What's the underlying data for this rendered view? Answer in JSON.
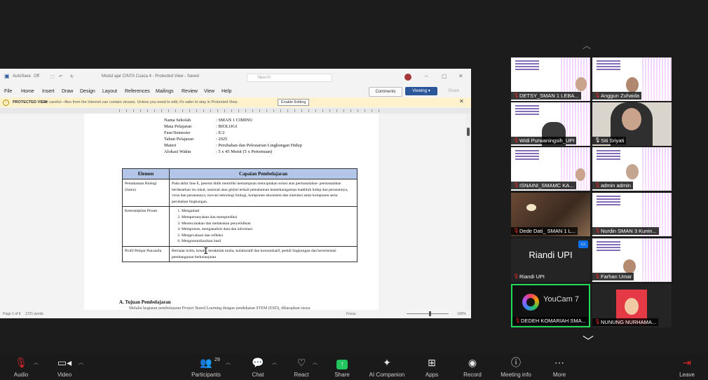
{
  "document": {
    "titlebar": {
      "autosave": "AutoSave",
      "autosave_state": "Off",
      "filename": "Modul ajar CINTA Cuaca 4  -  Protected View  -  Saved",
      "search_placeholder": "Search"
    },
    "menu": [
      "File",
      "Home",
      "Insert",
      "Draw",
      "Design",
      "Layout",
      "References",
      "Mailings",
      "Review",
      "View",
      "Help"
    ],
    "comments_label": "Comments",
    "viewing_label": "Viewing",
    "share_label": "Share",
    "protected_view": {
      "label": "PROTECTED VIEW",
      "message": "Be careful—files from the Internet can contain viruses. Unless you need to edit, it's safer to stay in Protected View.",
      "enable_button": "Enable Editing"
    },
    "status": {
      "page": "Page 1 of 6",
      "words": "1721 words",
      "focus": "Focus",
      "zoom": "100%"
    },
    "identity": [
      {
        "key": "Nama Sekolah",
        "value": ": SMAN 1 CIMINU"
      },
      {
        "key": "Mata Pelajaran",
        "value": ": BIOLOGI"
      },
      {
        "key": "Fase/Semester",
        "value": ": E/2"
      },
      {
        "key": "Tahun Pelajaran",
        "value": ": 2025"
      },
      {
        "key": "Materi",
        "value": ": Perubahan dan Pelestarian Lingkungan Hidup"
      },
      {
        "key": "Alokasi Waktu",
        "value": ": 5 x 45 Menit (5 x Pertemuan)"
      }
    ],
    "table": {
      "headers": [
        "Elemen",
        "Capaian Pembelajaran"
      ],
      "rows": [
        {
          "element": "Pemahaman Biologi (Sains)",
          "text": "Pada akhir fase E, peserta didik memiliki kemampuan menciptakan solusi atas permasalahan- permasalahan berdasarkan isu lokal, nasional atau global terkait pemahaman keanekaragaman makhluk hidup dan peranannya, virus dan peranannya, inovasi teknologi biologi, komponen ekosistem dan interaksi antar komponen serta perubahan lingkungan."
        },
        {
          "element": "Keterampilan Proses",
          "items": [
            "Mengamati",
            "Mempertanyakan dan memprediksi",
            "Merencanakan dan melakukan penyelidikan",
            "Memproses, menganalisis data dan informasi",
            "Mengevaluasi dan refleksi",
            "Mengomunikasikan hasil"
          ]
        },
        {
          "element": "Profil Pelajar Pancasila",
          "text": "Bernalar kritis, kreatif, berakhlak mulia, kolaboratif dan komunikatif,  peduli lingkungan dan berorientasi pembangunan berkelanjutan"
        }
      ]
    },
    "section_heading": "A.   Tujuan Pembelajaran",
    "section_para": "Melalui kegiatan pembelajaran Project Based Learning dengan pendekatan STEM (ESD),  diharapkan siswa"
  },
  "participants": [
    {
      "name": "DETSY_SMAN 1 LEBA...",
      "muted": true,
      "video": "slide"
    },
    {
      "name": "Anggun Zuhaida",
      "muted": true,
      "video": "slide-face"
    },
    {
      "name": "Widi Purwaningsih_UPI",
      "muted": true,
      "video": "slide-face"
    },
    {
      "name": "Siti Sriyati",
      "muted": false,
      "video": "face"
    },
    {
      "name": "ISNAINI_SMAMC KA...",
      "muted": true,
      "video": "slide"
    },
    {
      "name": "admin admin",
      "muted": true,
      "video": "slide-face"
    },
    {
      "name": "Dede Dati_ SMAN 1 L...",
      "muted": true,
      "video": "room"
    },
    {
      "name": "Nurdin SMAN 3 Kunin...",
      "muted": true,
      "video": "slide"
    },
    {
      "name": "Riandi UPI",
      "muted": true,
      "video": "name",
      "big_name": "Riandi UPI"
    },
    {
      "name": "Farhan Umar",
      "muted": true,
      "video": "slide-face"
    },
    {
      "name": "DEDEH KOMARIAH SMA...",
      "muted": true,
      "video": "youcam",
      "active": true,
      "youcam_text": "YouCam 7"
    },
    {
      "name": "NUNUNG NURHAMA...",
      "muted": true,
      "video": "avatar"
    }
  ],
  "toolbar": {
    "audio": "Audio",
    "video": "Video",
    "participants": "Participants",
    "participants_count": "29",
    "chat": "Chat",
    "react": "React",
    "share": "Share",
    "ai_companion": "AI Companion",
    "apps": "Apps",
    "record": "Record",
    "meeting_info": "Meeting info",
    "more": "More",
    "leave": "Leave"
  },
  "colors": {
    "word_blue": "#2b579a",
    "table_header": "#b4c6e7",
    "mute_red": "#e02828",
    "active_speaker": "#23d959",
    "share_green": "#23c55e"
  }
}
